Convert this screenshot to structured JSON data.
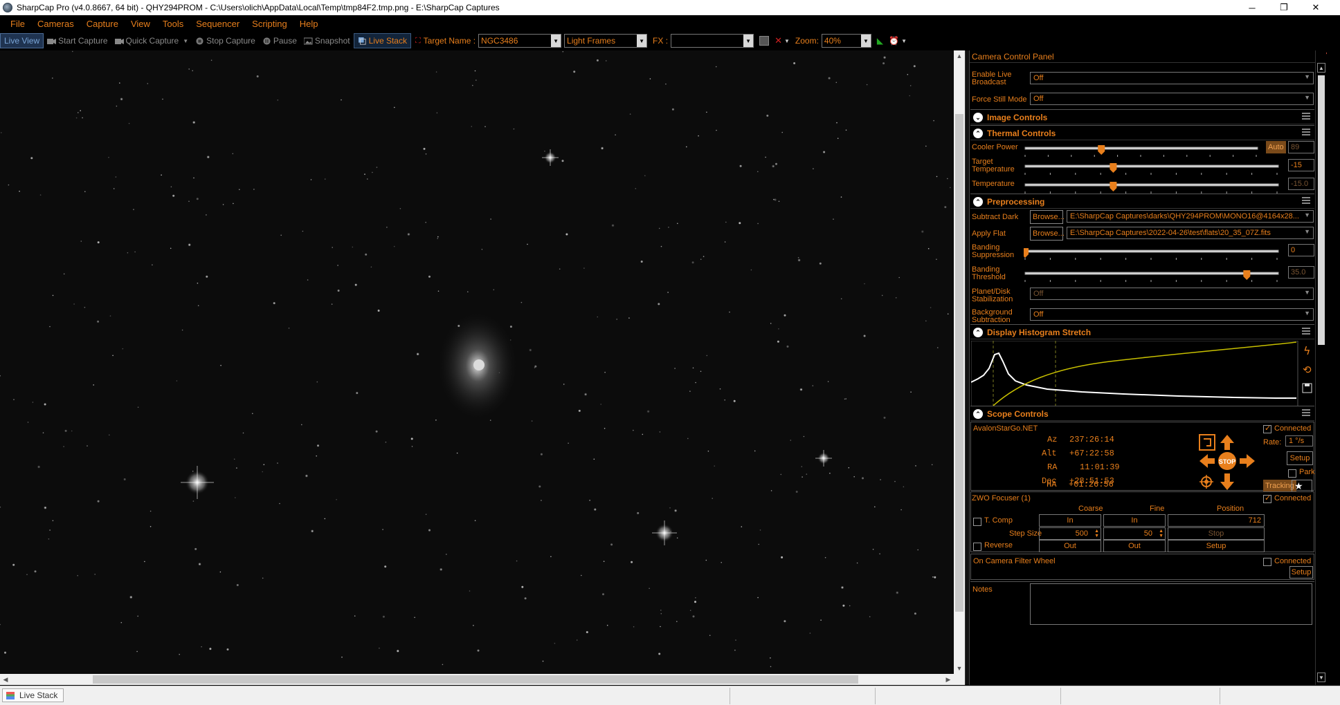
{
  "window": {
    "title": "SharpCap Pro (v4.0.8667, 64 bit) - QHY294PROM - C:\\Users\\olich\\AppData\\Local\\Temp\\tmp84F2.tmp.png - E:\\SharpCap Captures",
    "minimize": "─",
    "maximize": "❐",
    "close": "✕"
  },
  "menu": [
    "File",
    "Cameras",
    "Capture",
    "View",
    "Tools",
    "Sequencer",
    "Scripting",
    "Help"
  ],
  "toolbar": {
    "live_view": "Live View",
    "start_capture": "Start Capture",
    "quick_capture": "Quick Capture",
    "stop_capture": "Stop Capture",
    "pause": "Pause",
    "snapshot": "Snapshot",
    "live_stack": "Live Stack",
    "target_name_label": "Target Name :",
    "target_name_value": "NGC3486",
    "frame_type_value": "Light Frames",
    "fx_label": "FX :",
    "fx_value": "",
    "zoom_label": "Zoom:",
    "zoom_value": "40%"
  },
  "panel": {
    "header": "Camera Control Panel",
    "enable_live_broadcast_label": "Enable Live Broadcast",
    "enable_live_broadcast_value": "Off",
    "force_still_mode_label": "Force Still Mode",
    "force_still_mode_value": "Off",
    "sections": {
      "image_controls": "Image Controls",
      "thermal_controls": "Thermal Controls",
      "preprocessing": "Preprocessing",
      "display_histogram": "Display Histogram Stretch",
      "scope_controls": "Scope Controls"
    },
    "thermal": {
      "cooler_power_label": "Cooler Power",
      "cooler_power_auto": "Auto",
      "cooler_power_value": "89",
      "cooler_power_level": 0.33,
      "target_temp_label": "Target Temperature",
      "target_temp_value": "-15",
      "target_temp_level": 0.35,
      "temperature_label": "Temperature",
      "temperature_value": "-15.0",
      "temperature_level": 0.35
    },
    "preprocessing": {
      "subtract_dark_label": "Subtract Dark",
      "browse": "Browse...",
      "subtract_dark_value": "E:\\SharpCap Captures\\darks\\QHY294PROM\\MONO16@4164x28...",
      "apply_flat_label": "Apply Flat",
      "apply_flat_value": "E:\\SharpCap Captures\\2022-04-26\\test\\flats\\20_35_07Z.fits",
      "banding_suppression_label": "Banding Suppression",
      "banding_suppression_value": "0",
      "banding_suppression_level": 0.0,
      "banding_threshold_label": "Banding Threshold",
      "banding_threshold_value": "35.0",
      "banding_threshold_level": 0.88,
      "planet_disk_label": "Planet/Disk Stabilization",
      "planet_disk_value": "Off",
      "background_sub_label": "Background Subtraction",
      "background_sub_value": "Off"
    },
    "scope": {
      "mount_name": "AvalonStarGo.NET",
      "connected": "Connected",
      "az_label": "Az",
      "az_value": "237:26:14",
      "alt_label": "Alt",
      "alt_value": "+67:22:58",
      "ra_label": "RA",
      "ra_value": "11:01:39",
      "dec_label": "Dec",
      "dec_value": "+28:51:53",
      "ha_label": "HA",
      "ha_value": "+01:26:56",
      "rate_label": "Rate:",
      "rate_value": "1 °/s",
      "setup": "Setup",
      "park": "Park",
      "stop": "STOP",
      "tracking": "Tracking"
    },
    "focuser": {
      "name": "ZWO Focuser (1)",
      "connected": "Connected",
      "coarse": "Coarse",
      "fine": "Fine",
      "position": "Position",
      "t_comp": "T. Comp",
      "in": "In",
      "position_value": "712",
      "step_size_label": "Step Size",
      "coarse_step": "500",
      "fine_step": "50",
      "stop": "Stop",
      "reverse": "Reverse",
      "out": "Out",
      "setup": "Setup"
    },
    "filter_wheel": {
      "name": "On Camera Filter Wheel",
      "connected": "Connected",
      "setup": "Setup"
    },
    "notes_label": "Notes"
  },
  "statusbar": {
    "tab_label": "Live Stack"
  },
  "colors": {
    "accent": "#e87f1c",
    "background": "#000000",
    "histogram_curve": "#c8c000"
  },
  "icons": [
    "camera-icon",
    "stop-icon",
    "pause-icon",
    "snapshot-icon",
    "live-stack-icon",
    "arrow-up-icon",
    "arrow-down-icon",
    "arrow-left-icon",
    "arrow-right-icon",
    "target-icon",
    "star-icon"
  ]
}
